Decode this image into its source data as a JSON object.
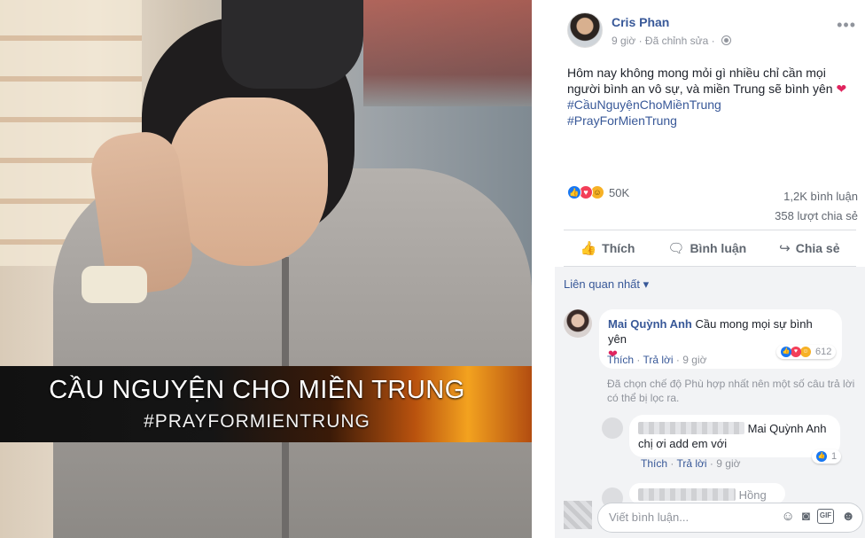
{
  "photo": {
    "banner_title": "CẦU NGUYỆN CHO MIỀN TRUNG",
    "banner_hashtag": "#PRAYFORMIENTRUNG"
  },
  "post": {
    "author": "Cris Phan",
    "time": "9 giờ",
    "edited": "Đã chỉnh sửa",
    "text": "Hôm nay không mong mỏi gì nhiều chỉ cần mọi người bình an vô sự, và miền Trung sẽ bình yên",
    "text_emoji": "❤",
    "hashtag1": "#CầuNguyệnChoMiềnTrung",
    "hashtag2": "#PrayForMienTrung",
    "reaction_count": "50K",
    "comment_count": "1,2K bình luận",
    "share_count": "358 lượt chia sẻ"
  },
  "actions": {
    "like": "Thích",
    "comment": "Bình luận",
    "share": "Chia sẻ"
  },
  "comments": {
    "sort_label": "Liên quan nhất",
    "c1": {
      "name": "Mai Quỳnh Anh",
      "text": "Cầu mong mọi sự bình yên",
      "emoji": "❤",
      "like": "Thích",
      "reply": "Trả lời",
      "time": "9 giờ",
      "reactions": "612"
    },
    "notice": "Đã chọn chế độ Phù hợp nhất nên một số câu trả lời có thể bị lọc ra.",
    "c2": {
      "mention": "Mai Quỳnh Anh",
      "text": "chị ơi add em với",
      "like": "Thích",
      "reply": "Trả lời",
      "time": "9 giờ",
      "reactions": "1"
    },
    "c3": {
      "partial_name": "Hồng"
    }
  },
  "composer": {
    "placeholder": "Viết bình luận..."
  },
  "icons": {
    "more": "more-horizontal-icon",
    "privacy": "globe-icon",
    "like": "thumbs-up-icon",
    "comment": "speech-bubble-icon",
    "share": "share-arrow-icon",
    "emoji": "smiley-icon",
    "camera": "camera-icon",
    "gif": "gif-icon",
    "sticker": "sticker-icon"
  },
  "colors": {
    "link": "#385898",
    "like_blue": "#1877f2",
    "love_red": "#f33e58",
    "haha_yellow": "#f7b125"
  }
}
